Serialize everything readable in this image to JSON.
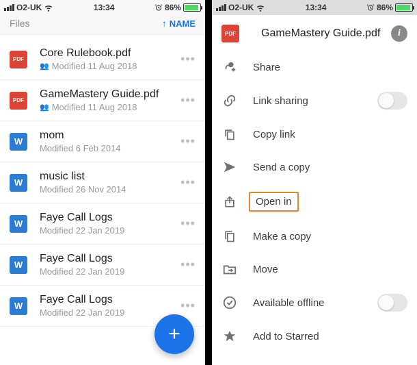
{
  "status": {
    "carrier": "O2-UK",
    "time": "13:34",
    "battery_pct": "86%"
  },
  "left": {
    "header_label": "Files",
    "sort_label": "NAME",
    "files": [
      {
        "icon": "pdf",
        "name": "Core Rulebook.pdf",
        "shared": true,
        "modified": "Modified 11 Aug 2018"
      },
      {
        "icon": "pdf",
        "name": "GameMastery Guide.pdf",
        "shared": true,
        "modified": "Modified 11 Aug 2018"
      },
      {
        "icon": "word",
        "name": "mom",
        "shared": false,
        "modified": "Modified 6 Feb 2014"
      },
      {
        "icon": "word",
        "name": "music list",
        "shared": false,
        "modified": "Modified 26 Nov 2014"
      },
      {
        "icon": "word",
        "name": "Faye Call Logs",
        "shared": false,
        "modified": "Modified 22 Jan 2019"
      },
      {
        "icon": "word",
        "name": "Faye Call Logs",
        "shared": false,
        "modified": "Modified 22 Jan 2019"
      },
      {
        "icon": "word",
        "name": "Faye Call Logs",
        "shared": false,
        "modified": "Modified 22 Jan 2019"
      }
    ]
  },
  "right": {
    "file_icon": "pdf",
    "file_name": "GameMastery Guide.pdf",
    "actions": [
      {
        "key": "share",
        "label": "Share",
        "toggle": false,
        "highlight": false
      },
      {
        "key": "link-sharing",
        "label": "Link sharing",
        "toggle": true,
        "highlight": false
      },
      {
        "key": "copy-link",
        "label": "Copy link",
        "toggle": false,
        "highlight": false
      },
      {
        "key": "send-copy",
        "label": "Send a copy",
        "toggle": false,
        "highlight": false
      },
      {
        "key": "open-in",
        "label": "Open in",
        "toggle": false,
        "highlight": true
      },
      {
        "key": "make-copy",
        "label": "Make a copy",
        "toggle": false,
        "highlight": false
      },
      {
        "key": "move",
        "label": "Move",
        "toggle": false,
        "highlight": false
      },
      {
        "key": "available-offline",
        "label": "Available offline",
        "toggle": true,
        "highlight": false
      },
      {
        "key": "add-starred",
        "label": "Add to Starred",
        "toggle": false,
        "highlight": false
      }
    ]
  }
}
